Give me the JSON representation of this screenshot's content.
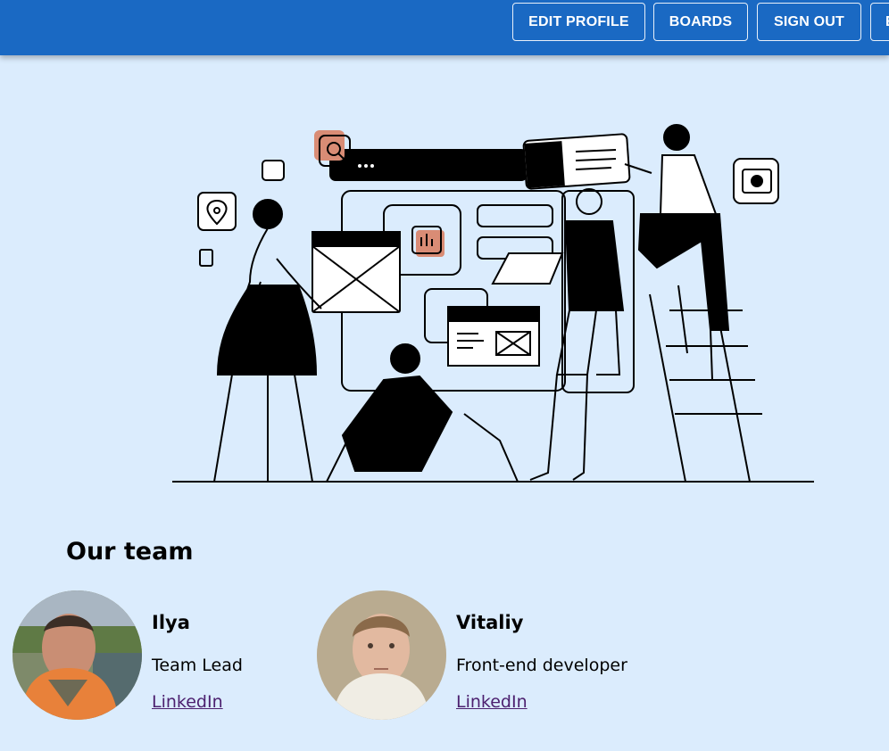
{
  "header": {
    "buttons": [
      {
        "label": "Edit profile"
      },
      {
        "label": "Boards"
      },
      {
        "label": "Sign out"
      },
      {
        "label": "E"
      }
    ]
  },
  "hero": {
    "illustration": "team-collaboration-illustration"
  },
  "team": {
    "title": "Our team",
    "members": [
      {
        "name": "Ilya",
        "role": "Team Lead",
        "link": "LinkedIn"
      },
      {
        "name": "Vitaliy",
        "role": "Front-end developer",
        "link": "LinkedIn"
      }
    ]
  },
  "colors": {
    "appbar": "#1a69c3",
    "background": "#dbecfd",
    "accent": "#d98c75",
    "link": "#4b1f6e"
  }
}
